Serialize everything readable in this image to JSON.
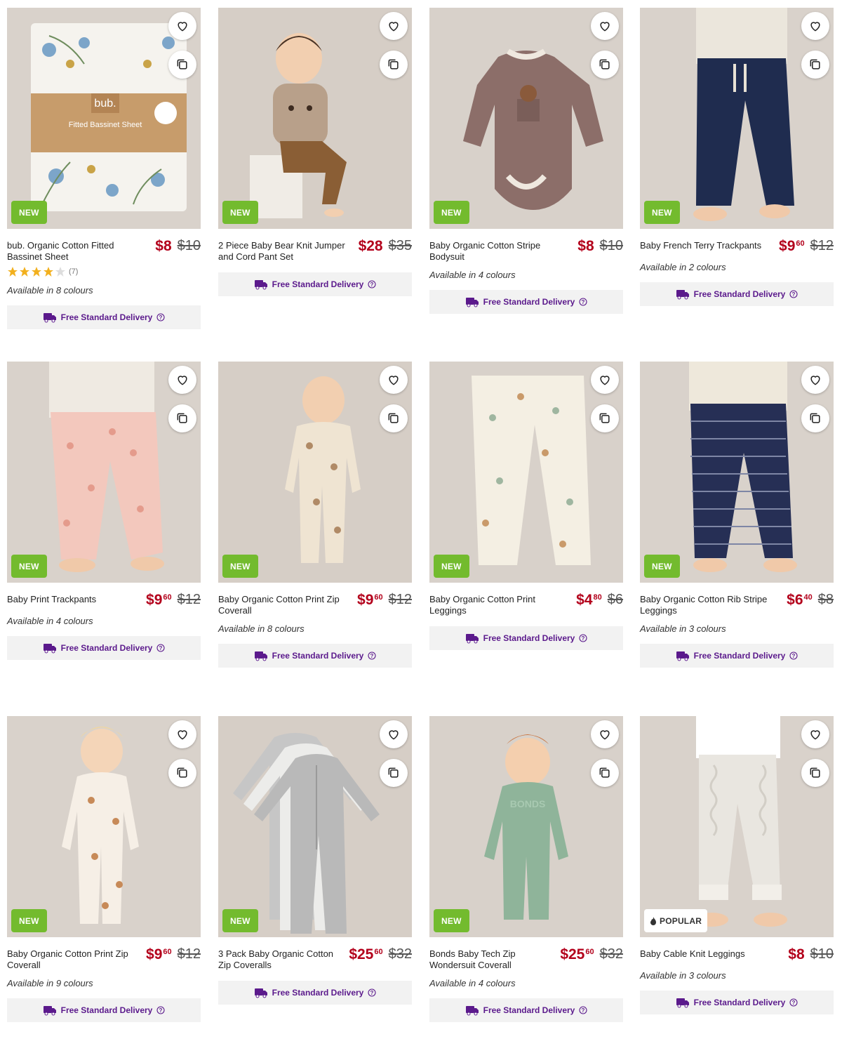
{
  "delivery_label": "Free Standard Delivery",
  "colors": {
    "price": "#b3001b",
    "new_badge": "#73bb2e",
    "delivery_text": "#5b1a8c"
  },
  "products": [
    {
      "name": "bub. Organic Cotton Fitted Bassinet Sheet",
      "badge": "NEW",
      "price_dollars": "$8",
      "price_cents": "",
      "was": "$10",
      "rating_stars": 4,
      "rating_count": "(7)",
      "colours": "Available in 8 colours",
      "icon": "bassinet-sheet-image",
      "package_brand": "bub.",
      "package_text": "Fitted Bassinet Sheet"
    },
    {
      "name": "2 Piece Baby Bear Knit Jumper and Cord Pant Set",
      "badge": "NEW",
      "price_dollars": "$28",
      "price_cents": "",
      "was": "$35",
      "colours": "",
      "icon": "knit-jumper-image"
    },
    {
      "name": "Baby Organic Cotton Stripe Bodysuit",
      "badge": "NEW",
      "price_dollars": "$8",
      "price_cents": "",
      "was": "$10",
      "colours": "Available in 4 colours",
      "icon": "bodysuit-image"
    },
    {
      "name": "Baby French Terry Trackpants",
      "badge": "NEW",
      "price_dollars": "$9",
      "price_cents": "60",
      "was": "$12",
      "colours": "Available in 2 colours",
      "icon": "trackpants-image"
    },
    {
      "name": "Baby Print Trackpants",
      "badge": "NEW",
      "price_dollars": "$9",
      "price_cents": "60",
      "was": "$12",
      "colours": "Available in 4 colours",
      "icon": "print-trackpants-image"
    },
    {
      "name": "Baby Organic Cotton Print Zip Coverall",
      "badge": "NEW",
      "price_dollars": "$9",
      "price_cents": "60",
      "was": "$12",
      "colours": "Available in 8 colours",
      "icon": "zip-coverall-image"
    },
    {
      "name": "Baby Organic Cotton Print Leggings",
      "badge": "NEW",
      "price_dollars": "$4",
      "price_cents": "80",
      "was": "$6",
      "colours": "",
      "icon": "print-leggings-image"
    },
    {
      "name": "Baby Organic Cotton Rib Stripe Leggings",
      "badge": "NEW",
      "price_dollars": "$6",
      "price_cents": "40",
      "was": "$8",
      "colours": "Available in 3 colours",
      "icon": "rib-leggings-image"
    },
    {
      "name": "Baby Organic Cotton Print Zip Coverall",
      "badge": "NEW",
      "price_dollars": "$9",
      "price_cents": "60",
      "was": "$12",
      "colours": "Available in 9 colours",
      "icon": "deer-coverall-image"
    },
    {
      "name": "3 Pack Baby Organic Cotton Zip Coveralls",
      "badge": "NEW",
      "price_dollars": "$25",
      "price_cents": "60",
      "was": "$32",
      "colours": "",
      "icon": "coverall-pack-image"
    },
    {
      "name": "Bonds Baby Tech Zip Wondersuit Coverall",
      "badge": "NEW",
      "price_dollars": "$25",
      "price_cents": "60",
      "was": "$32",
      "colours": "Available in 4 colours",
      "icon": "wondersuit-image",
      "garment_text": "BONDS"
    },
    {
      "name": "Baby Cable Knit Leggings",
      "badge": "POPULAR",
      "price_dollars": "$8",
      "price_cents": "",
      "was": "$10",
      "colours": "Available in 3 colours",
      "icon": "cable-leggings-image"
    }
  ]
}
